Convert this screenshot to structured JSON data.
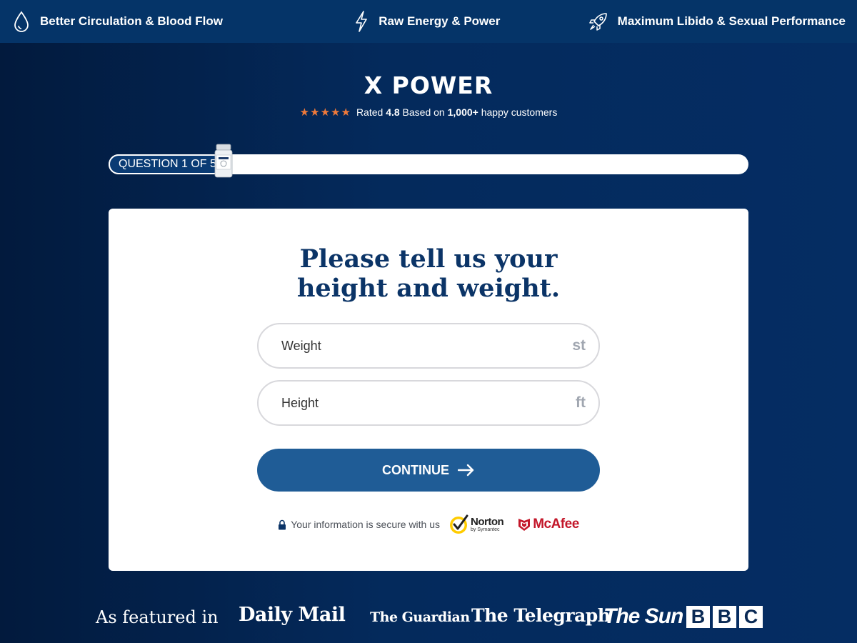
{
  "topbar": {
    "benefits": [
      {
        "icon": "water-drop-icon",
        "label": "Better Circulation & Blood Flow"
      },
      {
        "icon": "lightning-bolt-icon",
        "label": "Raw Energy & Power"
      },
      {
        "icon": "rocket-icon",
        "label": "Maximum Libido & Sexual Performance"
      }
    ]
  },
  "brand": {
    "name": "X POWER"
  },
  "rating": {
    "stars": 5,
    "star_color": "#f07a3a",
    "prefix": "Rated",
    "score": "4.8",
    "middle": "Based on",
    "count": "1,000+",
    "suffix": "happy customers"
  },
  "progress": {
    "label": "QUESTION 1 OF 5",
    "current": 1,
    "total": 5
  },
  "question": {
    "title": "Please tell us your height and weight."
  },
  "form": {
    "weight": {
      "placeholder": "Weight",
      "value": "",
      "unit": "st"
    },
    "height": {
      "placeholder": "Height",
      "value": "",
      "unit": "ft"
    },
    "continue_label": "CONTINUE"
  },
  "security": {
    "text": "Your information is secure with us",
    "norton_name": "Norton",
    "norton_sub": "by Symantec",
    "mcafee_name": "McAfee"
  },
  "featured": {
    "label": "As featured in",
    "logos": [
      "Daily Mail",
      "The Guardian",
      "The Telegraph",
      "The Sun"
    ],
    "bbc_letters": [
      "B",
      "B",
      "C"
    ]
  },
  "colors": {
    "accent": "#1f5c96",
    "heading": "#0b3467",
    "star": "#f07a3a",
    "mcafee": "#c3172a"
  }
}
